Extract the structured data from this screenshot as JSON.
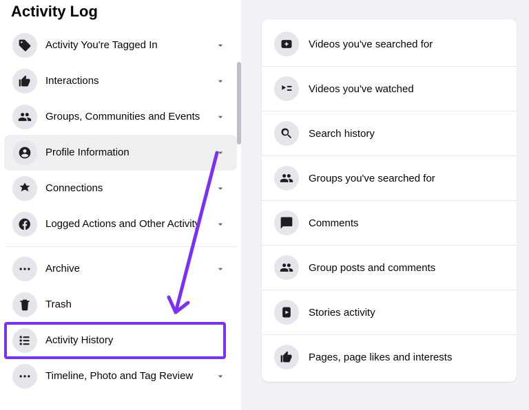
{
  "sidebar": {
    "title": "Activity Log",
    "section1": [
      {
        "label": "Activity You're Tagged In",
        "icon": "tag",
        "chevron": true
      },
      {
        "label": "Interactions",
        "icon": "thumb",
        "chevron": true
      },
      {
        "label": "Groups, Communities and Events",
        "icon": "groups",
        "chevron": true
      },
      {
        "label": "Profile Information",
        "icon": "profile",
        "chevron": true,
        "selected": true
      },
      {
        "label": "Connections",
        "icon": "connections",
        "chevron": true
      },
      {
        "label": "Logged Actions and Other Activity",
        "icon": "facebook",
        "chevron": true
      }
    ],
    "section2": [
      {
        "label": "Archive",
        "icon": "dots",
        "chevron": true
      },
      {
        "label": "Trash",
        "icon": "trash",
        "chevron": false
      },
      {
        "label": "Activity History",
        "icon": "list",
        "chevron": false
      },
      {
        "label": "Timeline, Photo and Tag Review",
        "icon": "dots",
        "chevron": true
      }
    ]
  },
  "main": {
    "rows": [
      {
        "label": "Videos you've searched for",
        "icon": "video-plus"
      },
      {
        "label": "Videos you've watched",
        "icon": "play-list"
      },
      {
        "label": "Search history",
        "icon": "search"
      },
      {
        "label": "Groups you've searched for",
        "icon": "groups"
      },
      {
        "label": "Comments",
        "icon": "comment"
      },
      {
        "label": "Group posts and comments",
        "icon": "groups"
      },
      {
        "label": "Stories activity",
        "icon": "stories"
      },
      {
        "label": "Pages, page likes and interests",
        "icon": "thumb"
      }
    ]
  },
  "annotation": {
    "color": "#7b2ff7"
  }
}
